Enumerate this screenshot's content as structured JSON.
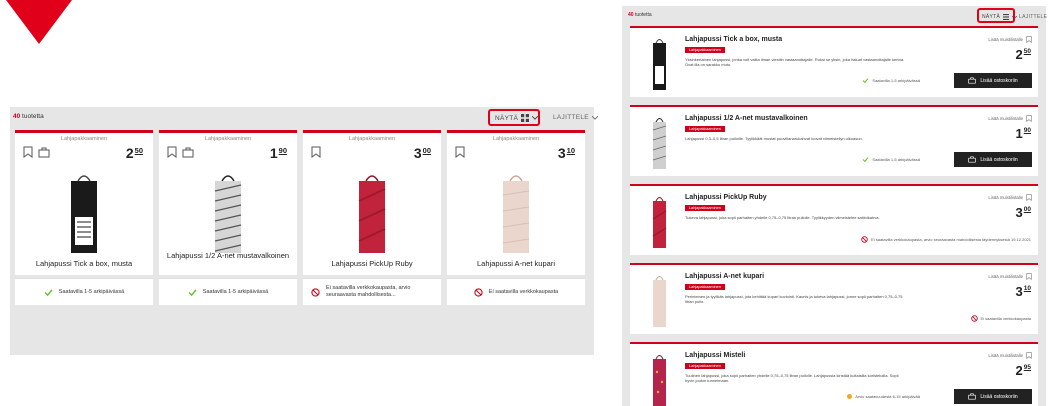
{
  "colors": {
    "accent": "#d0021b",
    "highlight": "#e1001a",
    "panel_bg": "#e6e6e6",
    "cart_button": "#222222"
  },
  "grid_view": {
    "count_number": "40",
    "count_label": "tuotetta",
    "view_toggle_label": "NÄYTÄ",
    "sort_label": "LAJITTELE",
    "cards": [
      {
        "category": "Lahjapakkaaminen",
        "price_main": "2",
        "price_cents": "50",
        "name": "Lahjapussi Tick a box, musta",
        "availability": "Saatavilla 1-5 arkipäivässä",
        "availability_icon": "check-icon",
        "bag_color": "#1a1a1a"
      },
      {
        "category": "Lahjapakkaaminen",
        "price_main": "1",
        "price_cents": "90",
        "name": "Lahjapussi 1/2 A-net mustavalkoinen",
        "availability": "Saatavilla 1-5 arkipäivässä",
        "availability_icon": "check-icon",
        "bag_color": "#cfcfcf"
      },
      {
        "category": "Lahjapakkaaminen",
        "price_main": "3",
        "price_cents": "00",
        "name": "Lahjapussi PickUp Ruby",
        "availability": "Ei saatavilla verkkokaupasta, arvio seuraavasta mahdollisesta...",
        "availability_icon": "not-available-icon",
        "bag_color": "#c0233b"
      },
      {
        "category": "Lahjapakkaaminen",
        "price_main": "3",
        "price_cents": "10",
        "name": "Lahjapussi A-net kupari",
        "availability": "Ei saatavilla verkkokaupasta",
        "availability_icon": "not-available-icon",
        "bag_color": "#ead6cc"
      }
    ]
  },
  "list_view": {
    "count_number": "40",
    "count_label": "tuotetta",
    "view_toggle_label": "NÄYTÄ",
    "sort_label": "LAJITTELE",
    "rows": [
      {
        "name": "Lahjapussi Tick a box, musta",
        "tag": "Lahjapakkaaminen",
        "description": "Yksinkertainen lahjapussi, jonka voit valita ilman viestiin vastaanottajalle. Ruksi se yksin, joka haluat vastaanottajalle kertoa. Ovat illa on sarakku mutu.",
        "wishlist": "Lisää muistilistalle",
        "price_main": "2",
        "price_cents": "50",
        "stock": "Saatavilla 1-5 arkipäivässä",
        "stock_icon": "check-icon",
        "cart": "Lisää ostoskoriin",
        "bag_color": "#1a1a1a"
      },
      {
        "name": "Lahjapussi 1/2 A-net mustavalkoinen",
        "tag": "Lahjapakkaaminen",
        "description": "Lahjapussi 0,3–0,5 litran pulloille. Tyylikkäät mustat puuvillanarukahvat luovat viimeistellyn ulkoasun.",
        "wishlist": "Lisää muistilistalle",
        "price_main": "1",
        "price_cents": "90",
        "stock": "Saatavilla 1-5 arkipäivässä",
        "stock_icon": "check-icon",
        "cart": "Lisää ostoskoriin",
        "bag_color": "#cfcfcf"
      },
      {
        "name": "Lahjapussi PickUp Ruby",
        "tag": "Lahjapakkaaminen",
        "description": "Tukeva lahjapussi, joka sopii parhaiten yhdelle 0,75–0,75 litran pullolle. Tyylikkyyden viimeistelee satiinikahva.",
        "wishlist": "Lisää muistilistalle",
        "price_main": "3",
        "price_cents": "00",
        "stock": "Ei saatavilla verkkokaupasta, arvio seuraavasta mahdollisesta täydennyksestä 19.12.2021",
        "stock_icon": "not-available-icon",
        "cart": "",
        "bag_color": "#c0233b"
      },
      {
        "name": "Lahjapussi A-net kupari",
        "tag": "Lahjapakkaaminen",
        "description": "Perinteinen ja tyylikäs lahjapussi, jota kehittää kupari kuviointi. Kaunis ja tukeva lahjapussi, jonne sopii parhaiten 0,75–0,75 litran pullo.",
        "wishlist": "Lisää muistilistalle",
        "price_main": "3",
        "price_cents": "10",
        "stock": "Ei saatavilla verkkokaupasta",
        "stock_icon": "not-available-icon",
        "cart": "",
        "bag_color": "#ead6cc"
      },
      {
        "name": "Lahjapussi Misteli",
        "tag": "Lahjapakkaaminen",
        "description": "Tuulinen lahjapussi, joka sopii parhaiten yhdelle 0,75–0,75 litran pullolle. Lahjapussia kiristää kultaisilla koristeluilla. Sopii hyvin joulun tunnelmaan.",
        "wishlist": "Lisää muistilistalle",
        "price_main": "2",
        "price_cents": "95",
        "stock": "Arvio saatavuudesta 6-15 arkipäivää",
        "stock_icon": "pending-dot-icon",
        "cart": "Lisää ostoskoriin",
        "bag_color": "#b5244a"
      }
    ]
  }
}
